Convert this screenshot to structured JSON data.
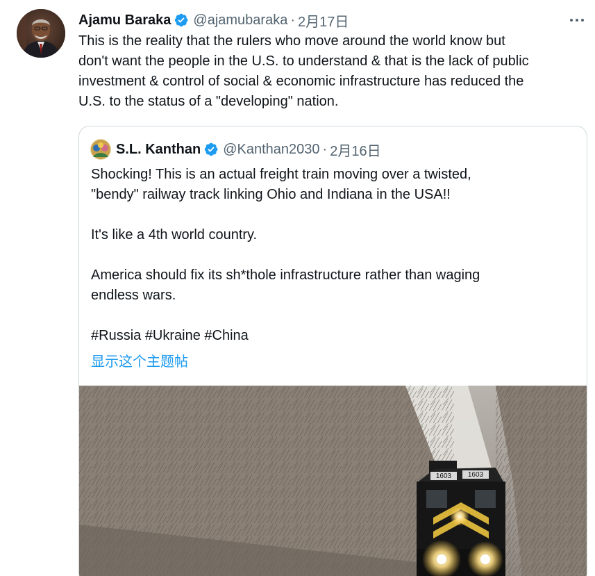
{
  "tweet": {
    "author_name": "Ajamu Baraka",
    "handle": "@ajamubaraka",
    "separator": "·",
    "date": "2月17日",
    "more_label": "···",
    "text": "This is the reality that the rulers who move around the world know but\ndon't want the people in the U.S. to understand & that is the lack of public\ninvestment & control of social & economic infrastructure has reduced the\nU.S. to the status of a \"developing\" nation."
  },
  "quoted_tweet": {
    "author_name": "S.L. Kanthan",
    "handle": "@Kanthan2030",
    "separator": "·",
    "date": "2月16日",
    "text": "Shocking! This is an actual freight train moving over a twisted,\n\"bendy\" railway track linking Ohio and Indiana in the USA!!\n\nIt's like a 4th world country.\n\nAmerica should fix its sh*thole infrastructure rather than waging\nendless wars.\n\n#Russia #Ukraine #China",
    "show_thread_label": "显示这个主题帖",
    "media": {
      "locomotive_number_left": "1603",
      "locomotive_number_right": "1603"
    }
  },
  "colors": {
    "verified": "#1d9bf0",
    "link": "#1d9bf0",
    "muted_text": "#536471",
    "border": "#cfd9de"
  }
}
